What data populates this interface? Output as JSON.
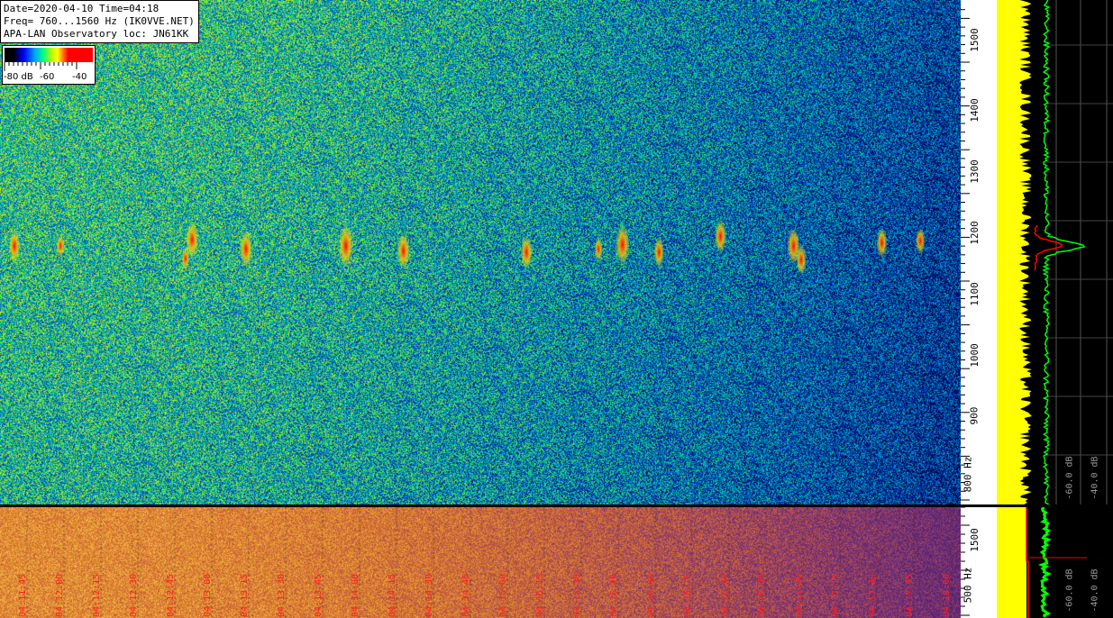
{
  "header": {
    "line1": "Date=2020-04-10 Time=04:18",
    "line2": "Freq= 760...1560 Hz (IK0VVE.NET)",
    "line3": "APA-LAN Observatory loc: JN61KK"
  },
  "color_scale": {
    "labels": [
      "-80 dB",
      "-60",
      "-40"
    ],
    "colors": [
      "#000000",
      "#0000ff",
      "#00a0ff",
      "#00ff80",
      "#ffff00",
      "#ff0000"
    ]
  },
  "chart_data": [
    {
      "type": "heatmap",
      "title": "",
      "xlabel": "",
      "ylabel": "Hz",
      "ylim": [
        760,
        1560
      ],
      "y_ticks": [
        "800 Hz",
        "900",
        "1000",
        "1100",
        "1200",
        "1300",
        "1400",
        "1500"
      ],
      "signal_frequency_hz": 1170,
      "signal_events": [
        {
          "t": 0.015,
          "f": 1170,
          "strength": 0.7
        },
        {
          "t": 0.063,
          "f": 1170,
          "strength": 0.4
        },
        {
          "t": 0.2,
          "f": 1180,
          "strength": 0.8
        },
        {
          "t": 0.193,
          "f": 1150,
          "strength": 0.4
        },
        {
          "t": 0.256,
          "f": 1165,
          "strength": 0.8
        },
        {
          "t": 0.36,
          "f": 1170,
          "strength": 1.0
        },
        {
          "t": 0.42,
          "f": 1162,
          "strength": 0.8
        },
        {
          "t": 0.548,
          "f": 1160,
          "strength": 0.7
        },
        {
          "t": 0.623,
          "f": 1165,
          "strength": 0.4
        },
        {
          "t": 0.648,
          "f": 1172,
          "strength": 0.9
        },
        {
          "t": 0.686,
          "f": 1160,
          "strength": 0.6
        },
        {
          "t": 0.75,
          "f": 1185,
          "strength": 0.7
        },
        {
          "t": 0.826,
          "f": 1170,
          "strength": 0.8
        },
        {
          "t": 0.834,
          "f": 1148,
          "strength": 0.6
        },
        {
          "t": 0.918,
          "f": 1175,
          "strength": 0.6
        },
        {
          "t": 0.958,
          "f": 1178,
          "strength": 0.5
        }
      ],
      "colors": {
        "low": "#000060",
        "mid": "#00c080",
        "high": "#ff0000"
      }
    },
    {
      "type": "heatmap",
      "title": "",
      "xlabel": "",
      "ylabel": "Hz",
      "y_ticks": [
        "500 Hz",
        "1500"
      ],
      "time_labels": [
        "04:11:45",
        "04:12:00",
        "04:12:15",
        "04:12:30",
        "04:12:45",
        "04:13:00",
        "04:13:15",
        "04:13:30",
        "04:13:45",
        "04:14:00",
        "04:14:15",
        "04:14:30",
        "04:14:45",
        "04:15:00",
        "04:15:15",
        "04:15:30",
        "04:15:45",
        "04:16:00",
        "04:16:15",
        "04:16:30",
        "04:16:45",
        "04:17:00",
        "04:17:15",
        "04:17:30",
        "04:17:45",
        "04:18:00"
      ],
      "colors": {
        "low": "#3a1a8a",
        "mid": "#c05050",
        "high": "#ffd070"
      }
    },
    {
      "type": "line",
      "title": "",
      "xlabel": "",
      "ylabel": "",
      "db_labels": [
        "-60.0 dB",
        "-40.0 dB"
      ],
      "series_colors": [
        "#ffff00",
        "#00ff00",
        "#ff0000"
      ]
    }
  ]
}
